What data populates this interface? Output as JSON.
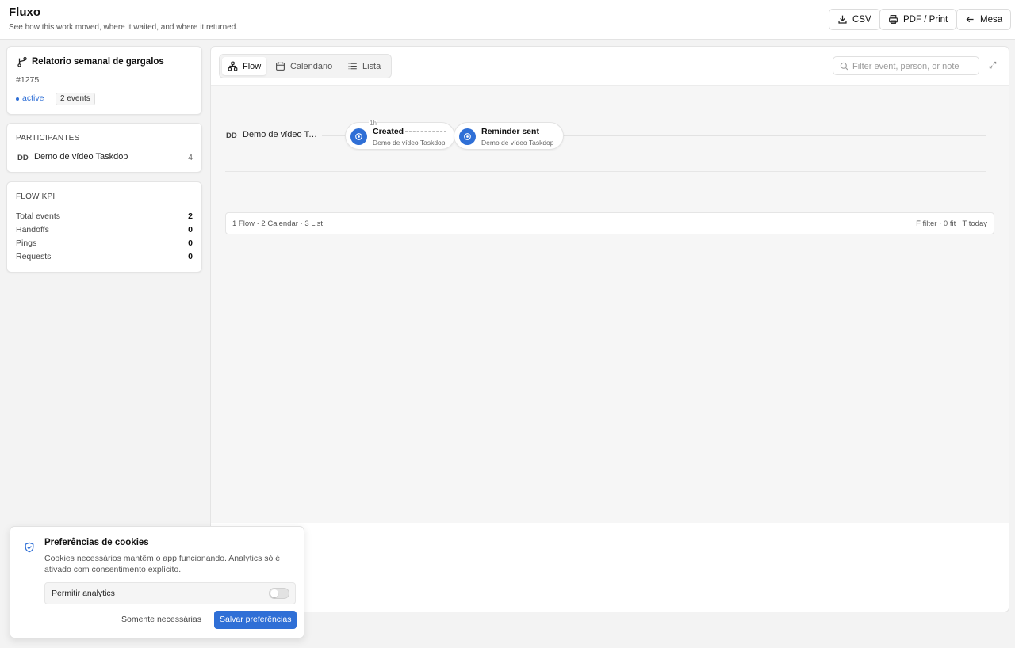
{
  "header": {
    "title": "Fluxo",
    "subtitle": "See how this work moved, where it waited, and where it returned.",
    "buttons": {
      "csv": "CSV",
      "print": "PDF / Print",
      "back": "Mesa"
    }
  },
  "task": {
    "title": "Relatorio semanal de gargalos",
    "id": "#1275",
    "status": "active",
    "events_badge": "2 events",
    "accent_color": "#2f6fd6"
  },
  "participants": {
    "label": "PARTICIPANTES",
    "items": [
      {
        "initials": "DD",
        "name": "Demo de vídeo Taskdop",
        "count": "4"
      }
    ]
  },
  "kpi": {
    "label": "FLOW KPI",
    "rows": [
      {
        "label": "Total events",
        "value": "2"
      },
      {
        "label": "Handoffs",
        "value": "0"
      },
      {
        "label": "Pings",
        "value": "0"
      },
      {
        "label": "Requests",
        "value": "0"
      }
    ]
  },
  "view_tabs": [
    {
      "label": "Flow",
      "icon": "flow-icon",
      "active": true
    },
    {
      "label": "Calendário",
      "icon": "calendar-icon",
      "active": false
    },
    {
      "label": "Lista",
      "icon": "list-icon",
      "active": false
    }
  ],
  "search": {
    "placeholder": "Filter event, person, or note",
    "value": ""
  },
  "lane": {
    "initials": "DD",
    "name": "Demo de vídeo Taskdop",
    "gap_label": "1h",
    "events": [
      {
        "title": "Created",
        "sub": "Demo de vídeo Taskdop"
      },
      {
        "title": "Reminder sent",
        "sub": "Demo de vídeo Taskdop"
      }
    ]
  },
  "statusbar": {
    "left": "1 Flow · 2 Calendar · 3 List",
    "right": "F filter · 0 fit · T today"
  },
  "cookie": {
    "title": "Preferências de cookies",
    "text": "Cookies necessários mantêm o app funcionando. Analytics só é ativado com consentimento explícito.",
    "toggle_label": "Permitir analytics",
    "toggle_on": false,
    "secondary_button": "Somente necessárias",
    "primary_button": "Salvar preferências"
  }
}
